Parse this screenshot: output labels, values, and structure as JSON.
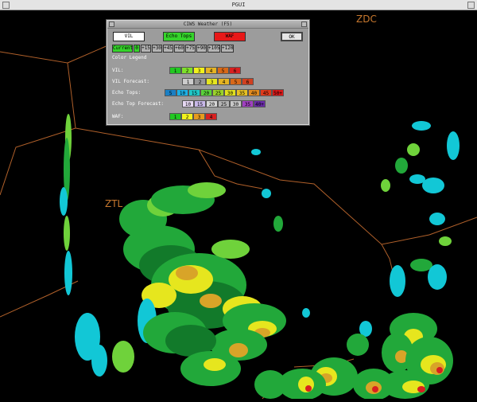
{
  "window": {
    "title": "PGUI"
  },
  "map": {
    "center_labels": [
      {
        "name": "ztl",
        "text": "ZTL"
      },
      {
        "name": "zdc",
        "text": "ZDC"
      }
    ],
    "boundary_color": "#b0602a",
    "radar_colors": {
      "cyan": "#12c7d6",
      "green_light": "#6fd23b",
      "green": "#22a83a",
      "green_dark": "#127a2a",
      "yellow": "#e6e61e",
      "orange": "#d8a428",
      "red": "#d82020"
    }
  },
  "dialog": {
    "title": "CIWS Weather (F5)",
    "buttons": {
      "vil": "VIL",
      "echo_tops": "Echo Tops",
      "waf": "WAF",
      "ok": "OK"
    },
    "time_buttons": [
      "Current",
      "0",
      "+15",
      "+30",
      "+45",
      "+60",
      "+75",
      "+90",
      "+105",
      "+120"
    ],
    "legend_title": "Color Legend",
    "legend": [
      {
        "label": "VIL:",
        "items": [
          {
            "text": "1",
            "color": "#22c822"
          },
          {
            "text": "2",
            "color": "#7ee02a"
          },
          {
            "text": "3",
            "color": "#f2f21c"
          },
          {
            "text": "4",
            "color": "#e6b422"
          },
          {
            "text": "5",
            "color": "#d86818"
          },
          {
            "text": "6",
            "color": "#d82020"
          }
        ]
      },
      {
        "label": "VIL Forecast:",
        "items": [
          {
            "text": "1",
            "color": "#cccccc"
          },
          {
            "text": "2",
            "color": "#969696"
          },
          {
            "text": "3",
            "color": "#e6e61e"
          },
          {
            "text": "4",
            "color": "#e6b422"
          },
          {
            "text": "5",
            "color": "#d86818"
          },
          {
            "text": "6",
            "color": "#d04020"
          }
        ]
      },
      {
        "label": "Echo Tops:",
        "items": [
          {
            "text": "5",
            "color": "#1a7fc4"
          },
          {
            "text": "10",
            "color": "#1cb0e6"
          },
          {
            "text": "15",
            "color": "#20c8c8"
          },
          {
            "text": "20",
            "color": "#5ad23a"
          },
          {
            "text": "25",
            "color": "#9ad22a"
          },
          {
            "text": "30",
            "color": "#e0e01e"
          },
          {
            "text": "35",
            "color": "#e6c022"
          },
          {
            "text": "40",
            "color": "#e08a1e"
          },
          {
            "text": "45",
            "color": "#e03a1a"
          },
          {
            "text": "50+",
            "color": "#d81818"
          }
        ]
      },
      {
        "label": "Echo Top Forecast:",
        "items": [
          {
            "text": "10",
            "color": "#e6d8f2"
          },
          {
            "text": "15",
            "color": "#c8b8e8"
          },
          {
            "text": "20",
            "color": "#d6d6d6"
          },
          {
            "text": "25",
            "color": "#b4b4b4"
          },
          {
            "text": "30",
            "color": "#c8c8c8"
          },
          {
            "text": "35",
            "color": "#a040c0"
          },
          {
            "text": "40+",
            "color": "#6a2aa8"
          }
        ]
      },
      {
        "label": "WAF:",
        "items": [
          {
            "text": "1",
            "color": "#22c822"
          },
          {
            "text": "2",
            "color": "#f2f21c"
          },
          {
            "text": "3",
            "color": "#e69a1e"
          },
          {
            "text": "4",
            "color": "#d82020"
          }
        ]
      }
    ]
  }
}
